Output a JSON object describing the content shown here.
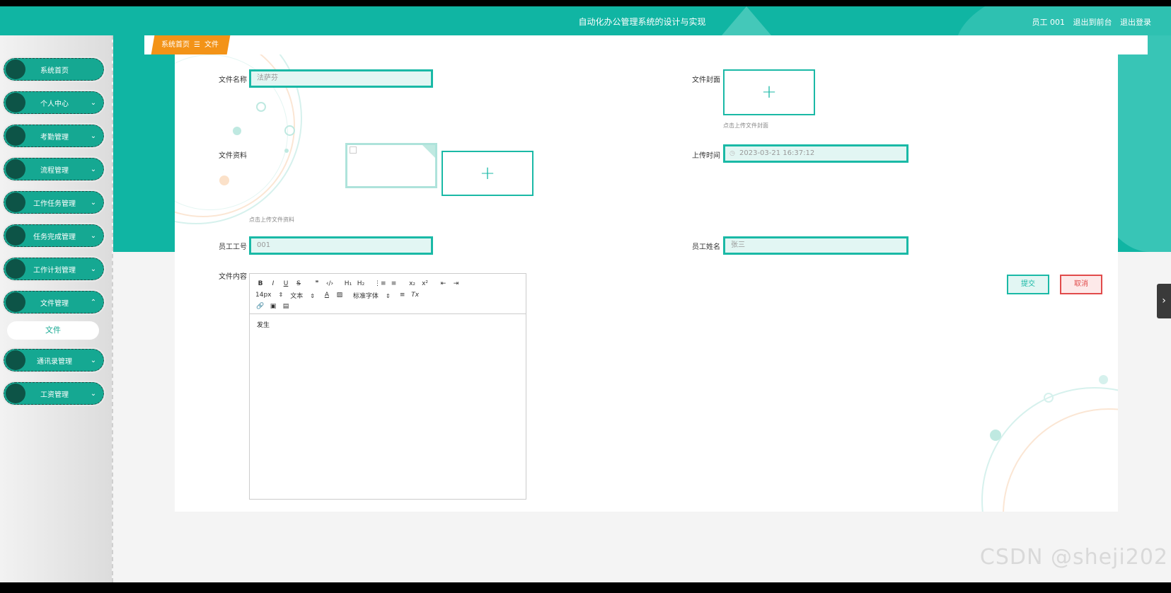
{
  "header": {
    "title": "自动化办公管理系统的设计与实现",
    "user_label": "员工 001",
    "back_to_front": "退出到前台",
    "logout": "退出登录"
  },
  "sidebar": {
    "items": [
      {
        "label": "系统首页",
        "chevron": ""
      },
      {
        "label": "个人中心",
        "chevron": "⌄"
      },
      {
        "label": "考勤管理",
        "chevron": "⌄"
      },
      {
        "label": "流程管理",
        "chevron": "⌄"
      },
      {
        "label": "工作任务管理",
        "chevron": "⌄"
      },
      {
        "label": "任务完成管理",
        "chevron": "⌄"
      },
      {
        "label": "工作计划管理",
        "chevron": "⌄"
      },
      {
        "label": "文件管理",
        "chevron": "⌃"
      },
      {
        "label": "通讯录管理",
        "chevron": "⌄"
      },
      {
        "label": "工资管理",
        "chevron": "⌄"
      }
    ],
    "sub_item": "文件"
  },
  "breadcrumb": {
    "home": "系统首页",
    "sep": "☰",
    "current": "文件"
  },
  "form": {
    "file_name_label": "文件名称",
    "file_name_value": "法萨芬",
    "cover_label": "文件封面",
    "cover_hint": "点击上传文件封面",
    "material_label": "文件资料",
    "material_hint": "点击上传文件资料",
    "upload_time_label": "上传时间",
    "upload_time_value": "2023-03-21 16:37:12",
    "employee_no_label": "员工工号",
    "employee_no_value": "001",
    "employee_name_label": "员工姓名",
    "employee_name_value": "张三",
    "content_label": "文件内容",
    "upload_plus": "+",
    "content_text": "发生"
  },
  "editor_toolbar": {
    "bold": "B",
    "italic": "I",
    "underline": "U",
    "strike": "S",
    "quote": "❞",
    "code": "‹/›",
    "h1": "H₁",
    "h2": "H₂",
    "ol": "⋮≡",
    "ul": "≡",
    "sub": "x₂",
    "sup": "x²",
    "indent_left": "⇤",
    "indent_right": "⇥",
    "size": "14px",
    "type": "文本",
    "color": "A",
    "bg": "▨",
    "font": "标准字体",
    "align": "≡",
    "clear": "Tx",
    "link": "🔗",
    "image": "▣",
    "video": "▤",
    "select_arrow": "⇕"
  },
  "buttons": {
    "submit": "提交",
    "cancel": "取消"
  },
  "side_tab": "›",
  "watermark": "CSDN @sheji202",
  "colors": {
    "primary": "#10b5a3",
    "accent": "#f39317",
    "danger": "#e14b4b"
  }
}
